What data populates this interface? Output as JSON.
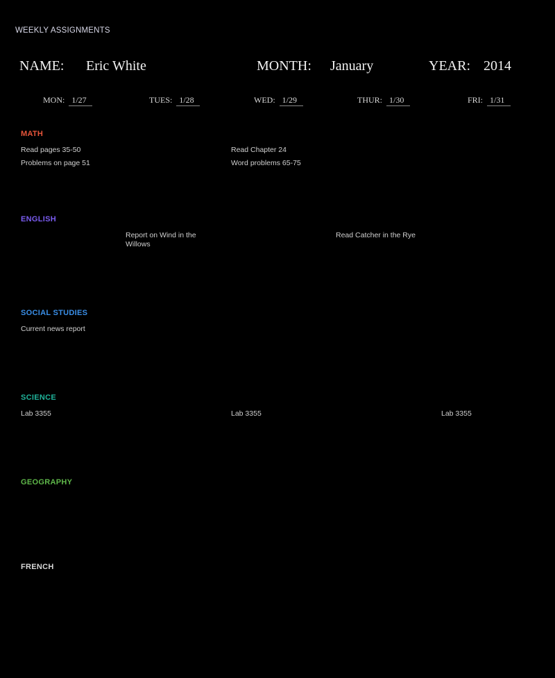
{
  "document": {
    "label": "WEEKLY ASSIGNMENTS"
  },
  "header": {
    "name_label": "NAME:",
    "name_value": "Eric White",
    "month_label": "MONTH:",
    "month_value": "January",
    "year_label": "YEAR:",
    "year_value": "2014"
  },
  "days": [
    {
      "label": "MON:",
      "date": "1/27"
    },
    {
      "label": "TUES:",
      "date": "1/28"
    },
    {
      "label": "WED:",
      "date": "1/29"
    },
    {
      "label": "THUR:",
      "date": "1/30"
    },
    {
      "label": "FRI:",
      "date": "1/31"
    }
  ],
  "sections": {
    "math": {
      "title": "MATH",
      "color": "#e8553a",
      "mon": [
        "Read pages 35-50",
        "Problems on page 51"
      ],
      "wed": [
        "Read Chapter 24",
        "Word problems 65-75"
      ]
    },
    "english": {
      "title": "ENGLISH",
      "color": "#7a5cf0",
      "tue": "Report on Wind in the Willows",
      "thu": "Read Catcher in the Rye"
    },
    "social_studies": {
      "title": "SOCIAL STUDIES",
      "color": "#3a8fe8",
      "mon": "Current news report"
    },
    "science": {
      "title": "SCIENCE",
      "color": "#1fb39a",
      "mon": "Lab 3355",
      "wed": "Lab 3355",
      "fri": "Lab 3355"
    },
    "geography": {
      "title": "GEOGRAPHY",
      "color": "#5fb84a"
    },
    "french": {
      "title": "FRENCH",
      "color": "#d8d8d8"
    }
  }
}
